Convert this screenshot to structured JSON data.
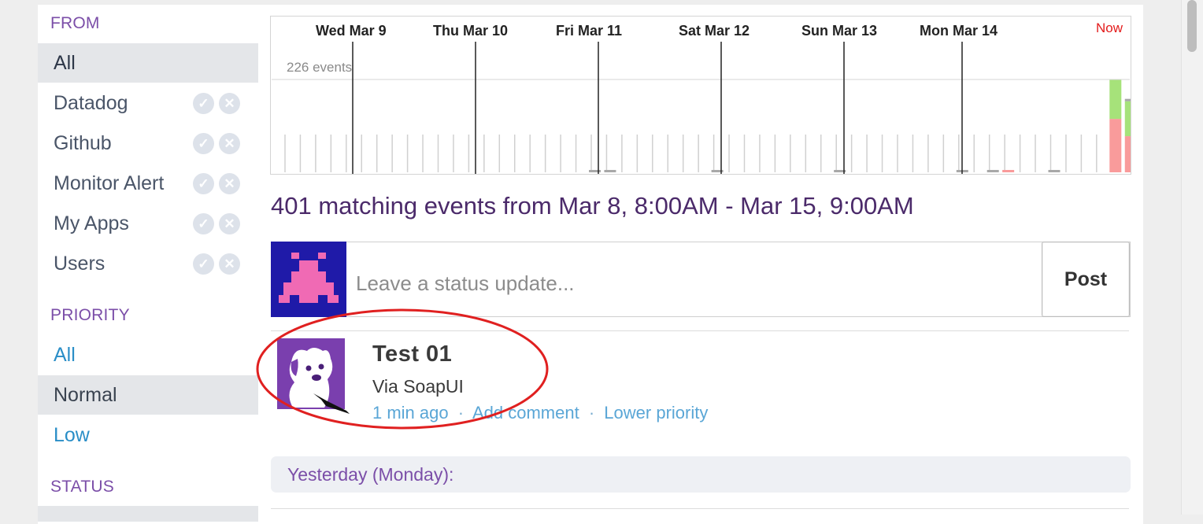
{
  "sidebar": {
    "from_heading": "FROM",
    "from_items": [
      {
        "label": "All",
        "selected": true,
        "toggles": false
      },
      {
        "label": "Datadog",
        "selected": false,
        "toggles": true
      },
      {
        "label": "Github",
        "selected": false,
        "toggles": true
      },
      {
        "label": "Monitor Alert",
        "selected": false,
        "toggles": true
      },
      {
        "label": "My Apps",
        "selected": false,
        "toggles": true
      },
      {
        "label": "Users",
        "selected": false,
        "toggles": true
      }
    ],
    "priority_heading": "PRIORITY",
    "priority_items": [
      {
        "label": "All",
        "selected": false
      },
      {
        "label": "Normal",
        "selected": true
      },
      {
        "label": "Low",
        "selected": false
      }
    ],
    "status_heading": "STATUS"
  },
  "timeline": {
    "day_labels": [
      "Wed Mar 9",
      "Thu Mar 10",
      "Fri Mar 11",
      "Sat Mar 12",
      "Sun Mar 13",
      "Mon Mar 14"
    ],
    "now_label": "Now",
    "max_label": "226 events",
    "colors": {
      "success": "#a6e27a",
      "error": "#f99b9b",
      "info": "#a8a8a8",
      "grid": "#d0d0d0",
      "day_line": "#222222"
    }
  },
  "chart_data": {
    "type": "bar",
    "title": "",
    "xlabel": "",
    "ylabel": "",
    "ymax": 226,
    "bars": [
      {
        "slot": 20,
        "gray": 3
      },
      {
        "slot": 21,
        "gray": 3
      },
      {
        "slot": 28,
        "gray": 3
      },
      {
        "slot": 36,
        "gray": 3
      },
      {
        "slot": 44,
        "gray": 3
      },
      {
        "slot": 46,
        "gray": 3
      },
      {
        "slot": 47,
        "red": 3
      },
      {
        "slot": 50,
        "gray": 3
      },
      {
        "slot": 54,
        "red": 130,
        "green": 95
      },
      {
        "slot": 55,
        "red": 88,
        "green": 85,
        "gray": 5
      },
      {
        "slot": 56,
        "green": 3
      },
      {
        "slot": 60,
        "gray": 3
      },
      {
        "slot": 62,
        "gray": 3
      },
      {
        "slot": 67,
        "gray": 3
      },
      {
        "slot": 69,
        "gray": 3
      }
    ]
  },
  "headline": "401 matching events from Mar 8, 8:00AM - Mar 15, 9:00AM",
  "status_update": {
    "placeholder": "Leave a status update...",
    "value": "",
    "post_label": "Post"
  },
  "event": {
    "title": "Test 01",
    "source": "Via SoapUI",
    "time": "1 min ago",
    "add_comment": "Add comment",
    "lower_priority": "Lower priority",
    "separator": "·"
  },
  "day_header": "Yesterday (Monday):"
}
